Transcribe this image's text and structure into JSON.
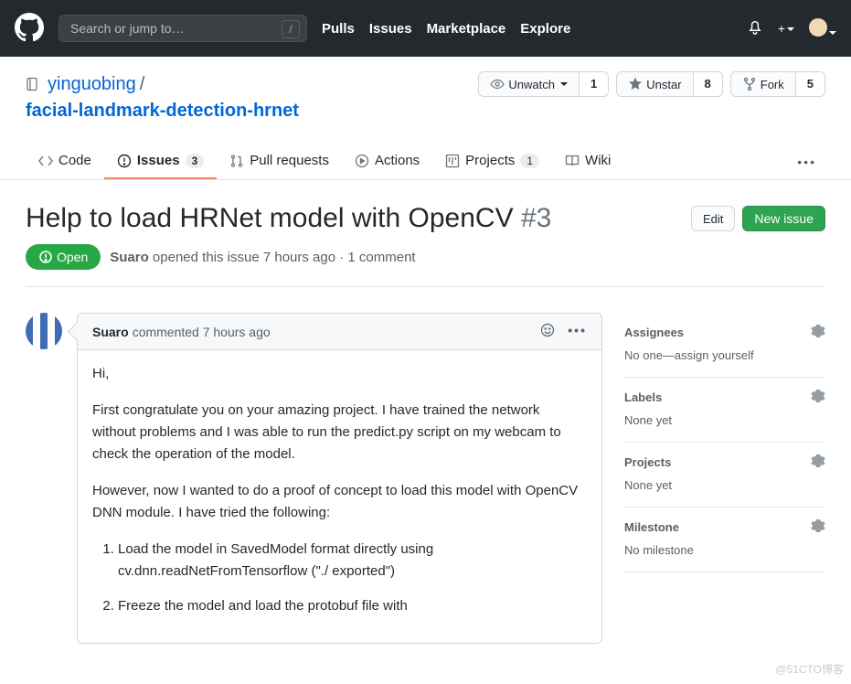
{
  "header": {
    "search_placeholder": "Search or jump to…",
    "slash": "/",
    "nav": {
      "pulls": "Pulls",
      "issues": "Issues",
      "marketplace": "Marketplace",
      "explore": "Explore"
    },
    "plus": "+"
  },
  "repo": {
    "owner": "yinguobing",
    "name": "facial-landmark-detection-hrnet",
    "watch_label": "Unwatch",
    "watch_count": "1",
    "star_label": "Unstar",
    "star_count": "8",
    "fork_label": "Fork",
    "fork_count": "5"
  },
  "tabs": {
    "code": "Code",
    "issues": "Issues",
    "issues_count": "3",
    "prs": "Pull requests",
    "actions": "Actions",
    "projects": "Projects",
    "projects_count": "1",
    "wiki": "Wiki"
  },
  "issue": {
    "title": "Help to load HRNet model with OpenCV",
    "number": "#3",
    "edit": "Edit",
    "new": "New issue",
    "state": "Open",
    "author": "Suaro",
    "meta_rest": " opened this issue 7 hours ago · 1 comment"
  },
  "comment": {
    "author": "Suaro",
    "time": " commented 7 hours ago",
    "p1": "Hi,",
    "p2": "First congratulate you on your amazing project. I have trained the network without problems and I was able to run the predict.py script on my webcam to check the operation of the model.",
    "p3": "However, now I wanted to do a proof of concept to load this model with OpenCV DNN module. I have tried the following:",
    "li1": "Load the model in SavedModel format directly using cv.dnn.readNetFromTensorflow (\"./ exported\")",
    "li2": "Freeze the model and load the protobuf file with"
  },
  "sidebar": {
    "assignees": {
      "title": "Assignees",
      "body": "No one—assign yourself"
    },
    "labels": {
      "title": "Labels",
      "body": "None yet"
    },
    "projects": {
      "title": "Projects",
      "body": "None yet"
    },
    "milestone": {
      "title": "Milestone",
      "body": "No milestone"
    }
  },
  "watermark": "@51CTO博客"
}
